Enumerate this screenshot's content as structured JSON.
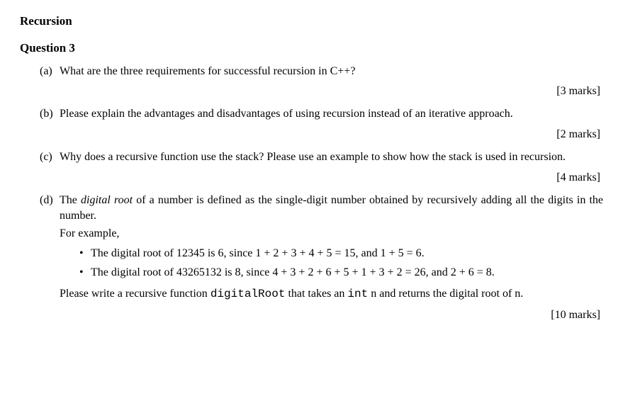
{
  "sectionTitle": "Recursion",
  "questionTitle": "Question 3",
  "parts": {
    "a": {
      "label": "(a)",
      "text": "What are the three requirements for successful recursion in C++?",
      "marks": "[3 marks]"
    },
    "b": {
      "label": "(b)",
      "text": "Please explain the advantages and disadvantages of using recursion instead of an iterative approach.",
      "marks": "[2 marks]"
    },
    "c": {
      "label": "(c)",
      "text": "Why does a recursive function use the stack? Please use an example to show how the stack is used in recursion.",
      "marks": "[4 marks]"
    },
    "d": {
      "label": "(d)",
      "introPre": "The ",
      "introItalic": "digital root",
      "introPost": " of a number is defined as the single-digit number obtained by recursively adding all the digits in the number.",
      "forExample": "For example,",
      "bullet1": "The digital root of 12345 is 6, since 1 + 2 + 3 + 4 + 5 = 15, and 1 + 5 = 6.",
      "bullet2": "The digital root of 43265132 is 8, since 4 + 3 + 2 + 6 + 5 + 1 + 3 + 2 = 26, and 2 + 6 = 8.",
      "outroPre": "Please write a recursive function ",
      "outroMono1": "digitalRoot",
      "outroMid": " that takes an ",
      "outroMono2": "int",
      "outroPost": " n and returns the digital root of n.",
      "marks": "[10 marks]",
      "bulletDot": "•"
    }
  }
}
